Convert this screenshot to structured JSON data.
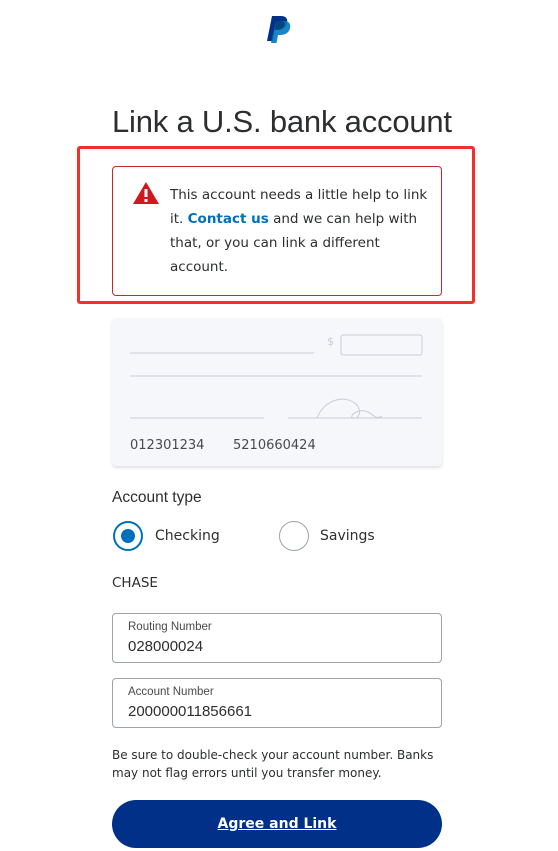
{
  "brand": {
    "logo_icon": "paypal-logo-icon",
    "primary_color": "#003087",
    "accent_color": "#0070ba",
    "error_color": "#c9262c"
  },
  "page": {
    "title": "Link a U.S. bank account"
  },
  "alert": {
    "icon": "warning-triangle-icon",
    "text_before": "This account needs a little help to link it. ",
    "link_label": "Contact us",
    "text_after": " and we can help with that, or you can link a different account."
  },
  "check_preview": {
    "routing_number": "012301234",
    "account_number": "5210660424",
    "dollar_sign": "$"
  },
  "account_type": {
    "label": "Account type",
    "options": [
      {
        "label": "Checking",
        "selected": true
      },
      {
        "label": "Savings",
        "selected": false
      }
    ]
  },
  "bank": {
    "name": "CHASE"
  },
  "fields": {
    "routing": {
      "label": "Routing Number",
      "value": "028000024"
    },
    "account": {
      "label": "Account Number",
      "value": "200000011856661"
    }
  },
  "disclaimer": "Be sure to double-check your account number. Banks may not flag errors until you transfer money.",
  "actions": {
    "primary_label": "Agree and Link"
  }
}
